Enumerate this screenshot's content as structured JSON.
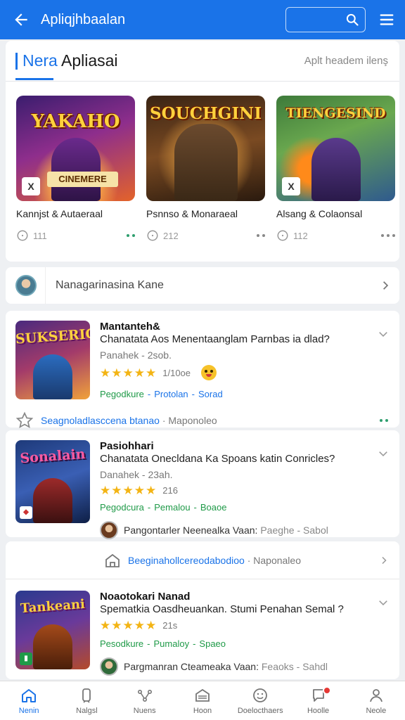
{
  "topbar": {
    "title": "Apliqjhbaalan",
    "search_value": ""
  },
  "featured": {
    "title_highlight": "Nera",
    "title_rest": "Apliasai",
    "link": "Aplt headem ilenş",
    "items": [
      {
        "thumb_title": "YAKAHO",
        "thumb_subtitle": "CINEMERE",
        "badge": "X",
        "name": "Kannjst & Autaeraal",
        "count": "111",
        "dots": "green"
      },
      {
        "thumb_title": "SOUCHGINI",
        "thumb_subtitle": "",
        "badge": "",
        "name": "Psnnso & Monaraeal",
        "count": "212",
        "dots": "grey"
      },
      {
        "thumb_title": "TIENGESIND",
        "thumb_subtitle": "",
        "badge": "X",
        "name": "Alsang & Colaonsal",
        "count": "112",
        "dots": "grey"
      }
    ]
  },
  "recommend": {
    "text": "Nanagarinasina Kane"
  },
  "apps": [
    {
      "icon_title": "SUKSERIG",
      "name": "Mantanteh&",
      "description": "Chanatata Aos Menentaanglam Parnbas ia dlad?",
      "developer": "Panahek - 2sob.",
      "rating_count": "1/10oe",
      "tags": [
        "Pegodkure",
        "Protolan",
        "Sorad"
      ],
      "footer_main": "Seagnoladlasccena btanao",
      "footer_sub": "Maponoleo"
    },
    {
      "icon_title": "Sonalain",
      "name": "Pasiohhari",
      "description": "Chanatata Onecldana Ka Spoans katin Conricles?",
      "developer": "Danahek - 23ah.",
      "rating_count": "216",
      "tags": [
        "Pegodcura",
        "Pemalou",
        "Boaoe"
      ],
      "dev_row_main": "Pangontarler Neenealka Vaan:",
      "dev_row_sub": "Paeghe - Sabol"
    },
    {
      "icon_title": "Tankeani",
      "name": "Noaotokari Nanad",
      "description": "Spematkia Oasdheuankan. Stumi Penahan Semal ?",
      "developer": "",
      "rating_count": "21s",
      "tags": [
        "Pesodkure",
        "Pumaloy",
        "Spaeo"
      ],
      "dev_row_main": "Pargmanran Cteameaka Vaan:",
      "dev_row_sub": "Feaoks - Sahdl"
    }
  ],
  "middle_row": {
    "main": "Beeginahollcereodabodioo",
    "sub": "Naponaleo"
  },
  "bottom_nav": [
    {
      "label": "Nenin",
      "icon": "home-icon",
      "active": true
    },
    {
      "label": "Nalgsl",
      "icon": "phone-icon",
      "active": false
    },
    {
      "label": "Nuens",
      "icon": "share-icon",
      "active": false
    },
    {
      "label": "Hoon",
      "icon": "inbox-icon",
      "active": false
    },
    {
      "label": "Doelocthaers",
      "icon": "smile-icon",
      "active": false
    },
    {
      "label": "Hoolle",
      "icon": "notification-icon",
      "active": false
    },
    {
      "label": "Neole",
      "icon": "profile-icon",
      "active": false
    }
  ],
  "colors": {
    "primary": "#1a73e8",
    "star": "#f3b414",
    "tag_green": "#1f9a48"
  }
}
